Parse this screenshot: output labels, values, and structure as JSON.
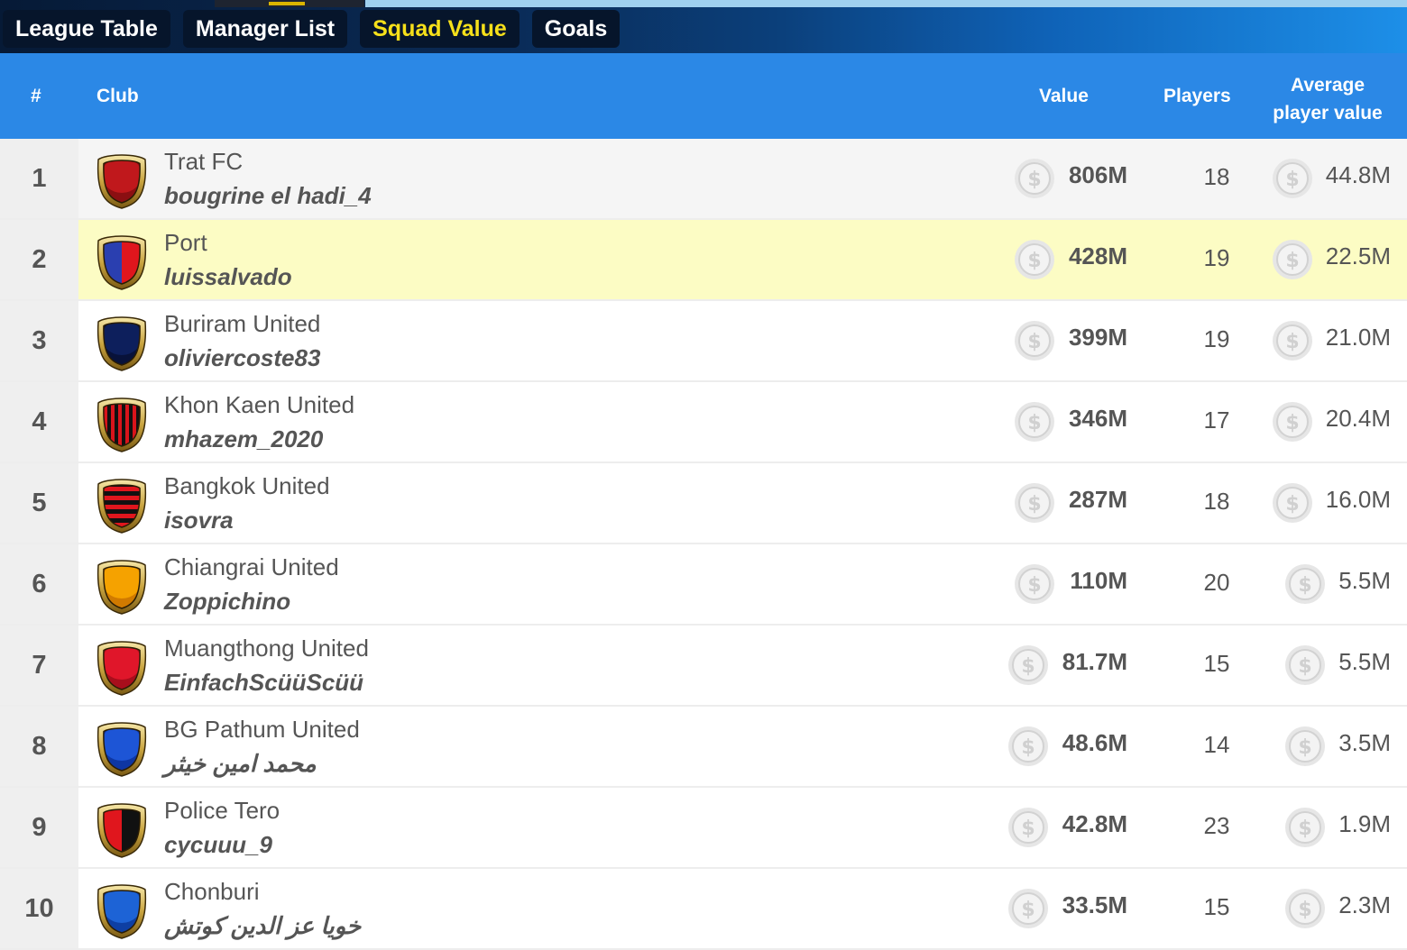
{
  "tabs": [
    {
      "label": "League Table",
      "active": false
    },
    {
      "label": "Manager List",
      "active": false
    },
    {
      "label": "Squad Value",
      "active": true
    },
    {
      "label": "Goals",
      "active": false
    }
  ],
  "columns": {
    "rank": "#",
    "club": "Club",
    "value": "Value",
    "players": "Players",
    "avg_line1": "Average",
    "avg_line2": "player value"
  },
  "colors": {
    "header_bg": "#2b88e6",
    "active_tab_text": "#f6e01a",
    "highlight_row": "#fcfcc4"
  },
  "rows": [
    {
      "rank": "1",
      "club": "Trat FC",
      "manager": "bougrine el hadi_4",
      "value": "806M",
      "players": "18",
      "avg": "44.8M",
      "crest": "solid",
      "colors": [
        "#c0181c",
        "#8b0f12"
      ]
    },
    {
      "rank": "2",
      "club": "Port",
      "manager": "luissalvado",
      "value": "428M",
      "players": "19",
      "avg": "22.5M",
      "crest": "split",
      "colors": [
        "#2a3fb0",
        "#e0161d"
      ],
      "highlight": true
    },
    {
      "rank": "3",
      "club": "Buriram United",
      "manager": "oliviercoste83",
      "value": "399M",
      "players": "19",
      "avg": "21.0M",
      "crest": "solid",
      "colors": [
        "#0d1f5c",
        "#08123a"
      ]
    },
    {
      "rank": "4",
      "club": "Khon Kaen United",
      "manager": "mhazem_2020",
      "value": "346M",
      "players": "17",
      "avg": "20.4M",
      "crest": "vstripes",
      "colors": [
        "#d9141b",
        "#111111"
      ]
    },
    {
      "rank": "5",
      "club": "Bangkok United",
      "manager": "isovra",
      "value": "287M",
      "players": "18",
      "avg": "16.0M",
      "crest": "hstripes",
      "colors": [
        "#e0161d",
        "#111111"
      ]
    },
    {
      "rank": "6",
      "club": "Chiangrai United",
      "manager": "Zoppichino",
      "value": "110M",
      "players": "20",
      "avg": "5.5M",
      "crest": "solid",
      "colors": [
        "#f5a200",
        "#d07a00"
      ]
    },
    {
      "rank": "7",
      "club": "Muangthong United",
      "manager": "EinfachScüüScüü",
      "value": "81.7M",
      "players": "15",
      "avg": "5.5M",
      "crest": "solid",
      "colors": [
        "#e0162a",
        "#a80e1c"
      ]
    },
    {
      "rank": "8",
      "club": "BG Pathum United",
      "manager": "محمد امین خیثر",
      "value": "48.6M",
      "players": "14",
      "avg": "3.5M",
      "crest": "solid",
      "colors": [
        "#1d55d6",
        "#0e36a3"
      ],
      "rtl": true
    },
    {
      "rank": "9",
      "club": "Police Tero",
      "manager": "cycuuu_9",
      "value": "42.8M",
      "players": "23",
      "avg": "1.9M",
      "crest": "split",
      "colors": [
        "#e0161d",
        "#111111"
      ]
    },
    {
      "rank": "10",
      "club": "Chonburi",
      "manager": "خویا عز الدین کوتش",
      "value": "33.5M",
      "players": "15",
      "avg": "2.3M",
      "crest": "solid",
      "colors": [
        "#1d63d6",
        "#0e3fa3"
      ],
      "rtl": true
    }
  ]
}
